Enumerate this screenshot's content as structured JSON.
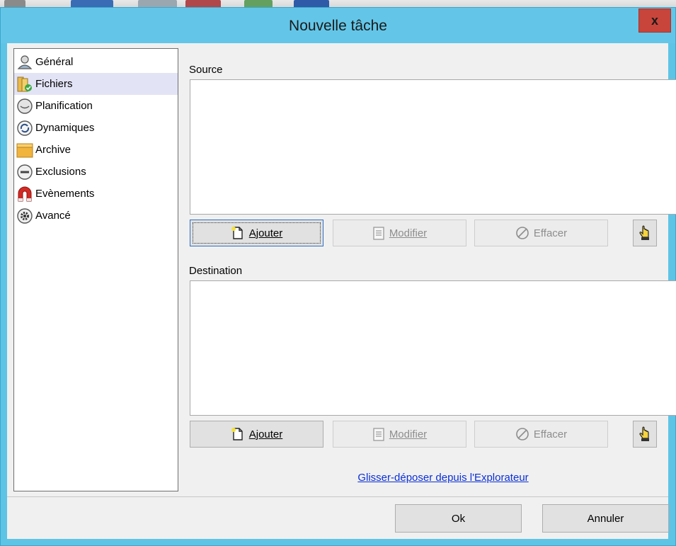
{
  "window": {
    "title": "Nouvelle tâche",
    "close_label": "x"
  },
  "sidebar": {
    "items": [
      {
        "label": "Général",
        "icon": "user-icon",
        "selected": false
      },
      {
        "label": "Fichiers",
        "icon": "files-icon",
        "selected": true
      },
      {
        "label": "Planification",
        "icon": "clock-icon",
        "selected": false
      },
      {
        "label": "Dynamiques",
        "icon": "sync-icon",
        "selected": false
      },
      {
        "label": "Archive",
        "icon": "archive-icon",
        "selected": false
      },
      {
        "label": "Exclusions",
        "icon": "exclusion-icon",
        "selected": false
      },
      {
        "label": "Evènements",
        "icon": "magnet-icon",
        "selected": false
      },
      {
        "label": "Avancé",
        "icon": "gear-icon",
        "selected": false
      }
    ]
  },
  "source": {
    "label": "Source",
    "add_label": "Ajouter",
    "modify_label": "Modifier",
    "delete_label": "Effacer"
  },
  "destination": {
    "label": "Destination",
    "add_label": "Ajouter",
    "modify_label": "Modifier",
    "delete_label": "Effacer"
  },
  "drag_drop_link": "Glisser-déposer depuis l'Explorateur",
  "footer": {
    "ok_label": "Ok",
    "cancel_label": "Annuler"
  },
  "colors": {
    "titlebar": "#63c6e8",
    "close": "#c8453b",
    "selection": "#e3e3f6",
    "link": "#0b2fd6"
  }
}
